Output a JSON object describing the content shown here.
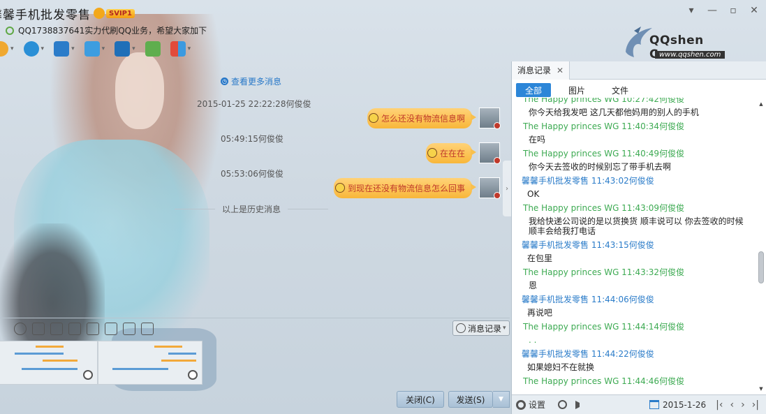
{
  "window": {
    "title": "馨馨手机批发零售",
    "vip_badge": "SVIP1",
    "signature": "QQ1738837641实力代刷QQ业务，希望大家加下"
  },
  "logo": {
    "name": "QQshen Course",
    "url_text": "www.qqshen.com"
  },
  "chat": {
    "more_link": "查看更多消息",
    "history_label": "以上是历史消息",
    "messages": [
      {
        "time": "2015-01-25 22:22:28何俊俊",
        "text": "怎么还没有物流信息啊"
      },
      {
        "time": "05:49:15何俊俊",
        "text": "在在在"
      },
      {
        "time": "05:53:06何俊俊",
        "text": "到现在还没有物流信息怎么回事"
      }
    ]
  },
  "input": {
    "msglog_label": "消息记录",
    "close_label": "关闭(C)",
    "send_label": "发送(S)"
  },
  "panel": {
    "tab_label": "消息记录",
    "filters": [
      "全部",
      "图片",
      "文件"
    ],
    "partial_header": "The Happy princes  WG 10:27:42何俊俊",
    "entries": [
      {
        "body": "你今天给我发吧   这几天都他妈用的别人的手机"
      },
      {
        "sender": "The Happy princes  WG 11:40:34何俊俊",
        "color": "green",
        "body": "在吗"
      },
      {
        "sender": "The Happy princes  WG 11:40:49何俊俊",
        "color": "green",
        "body": "你今天去签收的时候别忘了带手机去啊"
      },
      {
        "sender": "馨馨手机批发零售 11:43:02何俊俊",
        "color": "blue",
        "body": "OK"
      },
      {
        "sender": "The Happy princes  WG 11:43:09何俊俊",
        "color": "green",
        "body": "我给快递公司说的是以货换货   顺丰说可以   你去签收的时候顺丰会给我打电话"
      },
      {
        "sender": "馨馨手机批发零售 11:43:15何俊俊",
        "color": "blue",
        "body": "在包里"
      },
      {
        "sender": "The Happy princes  WG 11:43:32何俊俊",
        "color": "green",
        "body": "恩"
      },
      {
        "sender": "馨馨手机批发零售 11:44:06何俊俊",
        "color": "blue",
        "body": "再说吧"
      },
      {
        "sender": "The Happy princes  WG 11:44:14何俊俊",
        "color": "green",
        "body": ". ."
      },
      {
        "sender": "馨馨手机批发零售 11:44:22何俊俊",
        "color": "blue",
        "body": "如果媳妇不在就换"
      },
      {
        "sender": "The Happy princes  WG 11:44:46何俊俊",
        "color": "green",
        "body": ""
      }
    ],
    "footer": {
      "settings_label": "设置",
      "date": "2015-1-26"
    }
  }
}
